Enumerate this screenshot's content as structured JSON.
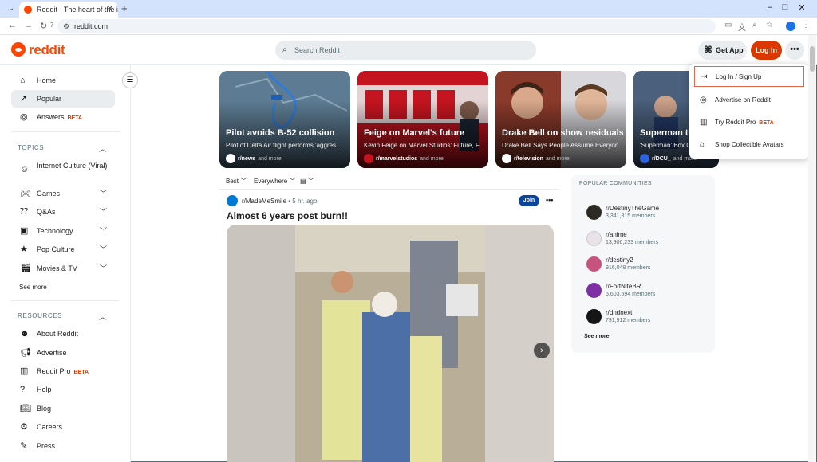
{
  "browser": {
    "tab_title": "Reddit - The heart of the inte",
    "url": "reddit.com",
    "reload_count": "7"
  },
  "header": {
    "logo_text": "reddit",
    "search_placeholder": "Search Reddit",
    "get_app_label": "Get App",
    "login_label": "Log In",
    "more_label": "•••"
  },
  "sidebar": {
    "main_items": [
      {
        "label": "Home",
        "icon": "home-icon"
      },
      {
        "label": "Popular",
        "icon": "popular-icon"
      },
      {
        "label": "Answers",
        "badge": "BETA",
        "icon": "answers-icon"
      }
    ],
    "topics_title": "TOPICS",
    "topics": [
      {
        "label": "Internet Culture (Viral)",
        "icon": "internet-culture-icon"
      },
      {
        "label": "Games",
        "icon": "games-icon"
      },
      {
        "label": "Q&As",
        "icon": "qa-icon"
      },
      {
        "label": "Technology",
        "icon": "technology-icon"
      },
      {
        "label": "Pop Culture",
        "icon": "pop-culture-icon"
      },
      {
        "label": "Movies & TV",
        "icon": "movies-icon"
      }
    ],
    "see_more": "See more",
    "resources_title": "RESOURCES",
    "resources": [
      {
        "label": "About Reddit",
        "icon": "about-icon"
      },
      {
        "label": "Advertise",
        "icon": "advertise-icon"
      },
      {
        "label": "Reddit Pro",
        "badge": "BETA",
        "icon": "reddit-pro-icon"
      },
      {
        "label": "Help",
        "icon": "help-icon"
      },
      {
        "label": "Blog",
        "icon": "blog-icon"
      },
      {
        "label": "Careers",
        "icon": "careers-icon"
      },
      {
        "label": "Press",
        "icon": "press-icon"
      }
    ]
  },
  "carousel": [
    {
      "title": "Pilot avoids B-52 collision",
      "subtitle": "Pilot of Delta Air flight performs 'aggres...",
      "source": "r/news",
      "more": "and more",
      "color": "#4a6d8a"
    },
    {
      "title": "Feige on Marvel's future",
      "subtitle": "Kevin Feige on Marvel Studios' Future, F...",
      "source": "r/marvelstudios",
      "more": "and more",
      "color": "#b3121b"
    },
    {
      "title": "Drake Bell on show residuals",
      "subtitle": "Drake Bell Says People Assume Everyon...",
      "source": "r/television",
      "more": "and more",
      "color": "#6b3a2c"
    },
    {
      "title": "Superman to",
      "subtitle": "'Superman' Box O",
      "source": "r/DCU_",
      "more": "and more",
      "color": "#3a4f6a"
    }
  ],
  "feed": {
    "sort": "Best",
    "location": "Everywhere",
    "view_icon": "view-layout-icon"
  },
  "post": {
    "subreddit": "r/MadeMeSmile",
    "time": "5 hr. ago",
    "join_label": "Join",
    "title": "Almost 6 years post burn!!"
  },
  "communities": {
    "title": "POPULAR COMMUNITIES",
    "items": [
      {
        "name": "r/DestinyTheGame",
        "members": "3,341,815 members",
        "color": "#2d2a22"
      },
      {
        "name": "r/anime",
        "members": "13,906,233 members",
        "color": "#e9e2e8"
      },
      {
        "name": "r/destiny2",
        "members": "916,048 members",
        "color": "#c6537b"
      },
      {
        "name": "r/FortNiteBR",
        "members": "5,603,594 members",
        "color": "#7d2fa3"
      },
      {
        "name": "r/dndnext",
        "members": "791,912 members",
        "color": "#151515"
      }
    ],
    "see_more": "See more"
  },
  "dropdown": [
    {
      "label": "Log In / Sign Up",
      "icon": "login-icon"
    },
    {
      "label": "Advertise on Reddit",
      "icon": "advertise-icon"
    },
    {
      "label": "Try Reddit Pro",
      "badge": "BETA",
      "icon": "chart-icon"
    },
    {
      "label": "Shop Collectible Avatars",
      "icon": "shop-icon"
    }
  ]
}
